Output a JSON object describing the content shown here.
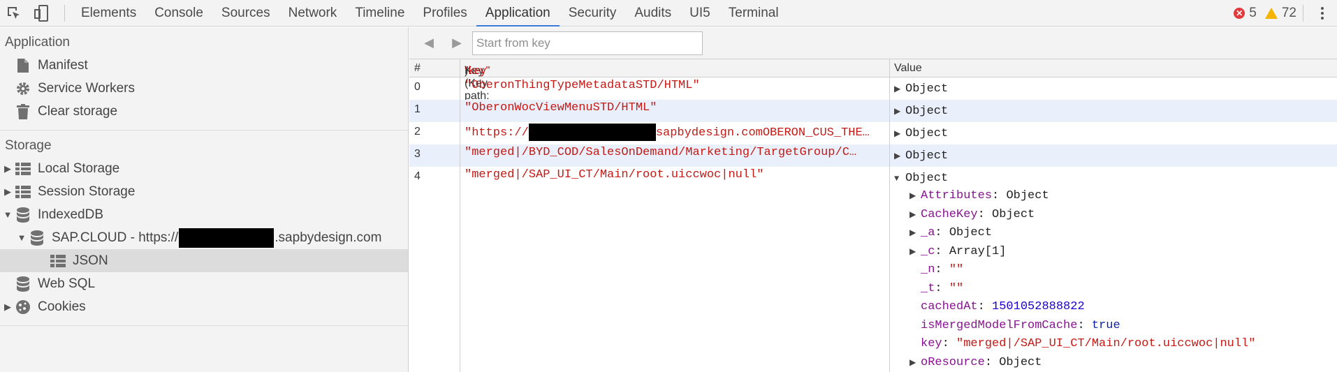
{
  "toolbar": {
    "tabs": [
      "Elements",
      "Console",
      "Sources",
      "Network",
      "Timeline",
      "Profiles",
      "Application",
      "Security",
      "Audits",
      "UI5",
      "Terminal"
    ],
    "active_tab": "Application",
    "errors": "5",
    "warnings": "72"
  },
  "sidebar": {
    "application_title": "Application",
    "application_items": [
      "Manifest",
      "Service Workers",
      "Clear storage"
    ],
    "storage_title": "Storage",
    "local_storage": "Local Storage",
    "session_storage": "Session Storage",
    "indexeddb": "IndexedDB",
    "db_prefix": "SAP.CLOUD - https://",
    "db_suffix": ".sapbydesign.com",
    "object_store": "JSON",
    "web_sql": "Web SQL",
    "cookies": "Cookies"
  },
  "main": {
    "search_placeholder": "Start from key",
    "columns": {
      "num": "#",
      "key_prefix": "Key (Key path: ",
      "key_path": "\"key\"",
      "key_suffix": ")",
      "value": "Value"
    },
    "rows": [
      {
        "num": "0",
        "key": "\"OberonThingTypeMetadataSTD/HTML\"",
        "value": "Object"
      },
      {
        "num": "1",
        "key": "\"OberonWocViewMenuSTD/HTML\"",
        "value": "Object"
      },
      {
        "num": "2",
        "key_prefix": "\"https://",
        "key_suffix": "sapbydesign.comOBERON_CUS_THE…",
        "value": "Object"
      },
      {
        "num": "3",
        "key": "\"merged|/BYD_COD/SalesOnDemand/Marketing/TargetGroup/C…",
        "value": "Object"
      },
      {
        "num": "4",
        "key": "\"merged|/SAP_UI_CT/Main/root.uiccwoc|null\"",
        "value": "Object"
      }
    ],
    "expanded": {
      "props": [
        {
          "name": "Attributes",
          "value": "Object",
          "kind": "obj"
        },
        {
          "name": "CacheKey",
          "value": "Object",
          "kind": "obj"
        },
        {
          "name": "_a",
          "value": "Object",
          "kind": "obj"
        },
        {
          "name": "_c",
          "value": "Array[1]",
          "kind": "obj"
        },
        {
          "name": "_n",
          "value": "\"\"",
          "kind": "str"
        },
        {
          "name": "_t",
          "value": "\"\"",
          "kind": "str"
        },
        {
          "name": "cachedAt",
          "value": "1501052888822",
          "kind": "num"
        },
        {
          "name": "isMergedModelFromCache",
          "value": "true",
          "kind": "bool"
        },
        {
          "name": "key",
          "value": "\"merged|/SAP_UI_CT/Main/root.uiccwoc|null\"",
          "kind": "str"
        },
        {
          "name": "oResource",
          "value": "Object",
          "kind": "obj"
        }
      ]
    }
  },
  "colors": {
    "active_tab_underline": "#3879d9",
    "string": "#c41a16",
    "property": "#881391",
    "number": "#1c00cf",
    "row_alt": "#eaf0fb"
  }
}
